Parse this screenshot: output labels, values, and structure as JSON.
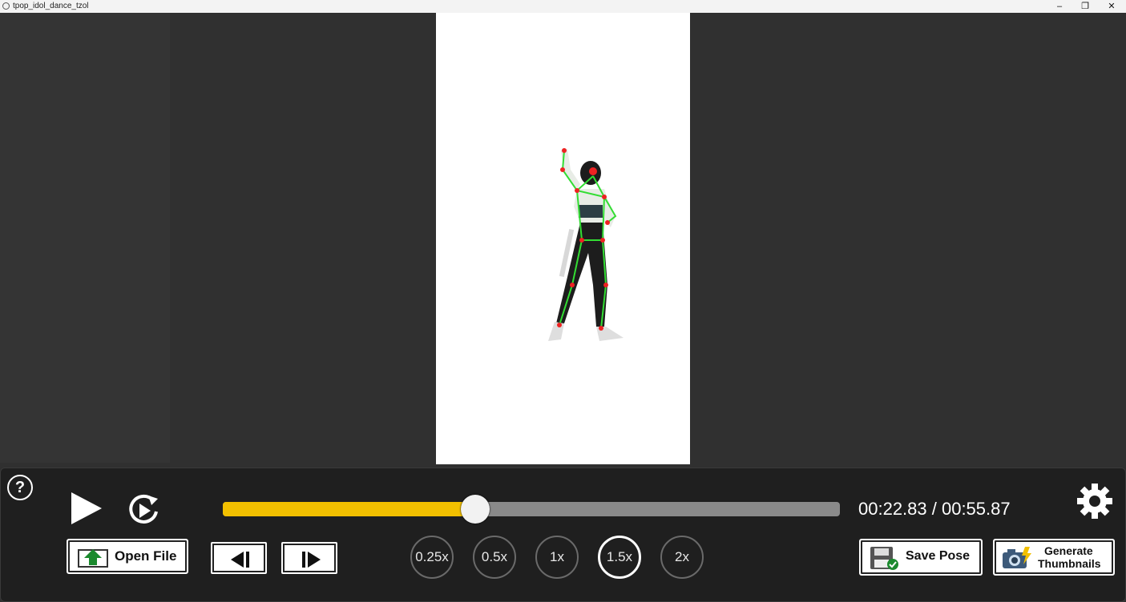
{
  "window": {
    "title": "tpop_idol_dance_tzol",
    "minimize_label": "–",
    "restore_label": "❐",
    "close_label": "✕"
  },
  "video": {
    "description_icon": "pose-skeleton-overlay"
  },
  "controls": {
    "help_label": "?",
    "play_icon": "play-icon",
    "replay_icon": "replay-icon",
    "seek": {
      "progress": 0.4085
    },
    "time_display": "00:22.83 / 00:55.87",
    "settings_icon": "gear-icon",
    "open_file_label": "Open File",
    "step_back_icon": "step-back-icon",
    "step_forward_icon": "step-forward-icon",
    "speeds": [
      {
        "label": "0.25x",
        "active": false
      },
      {
        "label": "0.5x",
        "active": false
      },
      {
        "label": "1x",
        "active": false
      },
      {
        "label": "1.5x",
        "active": true
      },
      {
        "label": "2x",
        "active": false
      }
    ],
    "save_pose_label": "Save Pose",
    "generate_label_line1": "Generate",
    "generate_label_line2": "Thumbnails"
  },
  "colors": {
    "seek_fill": "#f2c000",
    "skeleton_bone": "#33dd33",
    "skeleton_joint": "#ee2222"
  }
}
